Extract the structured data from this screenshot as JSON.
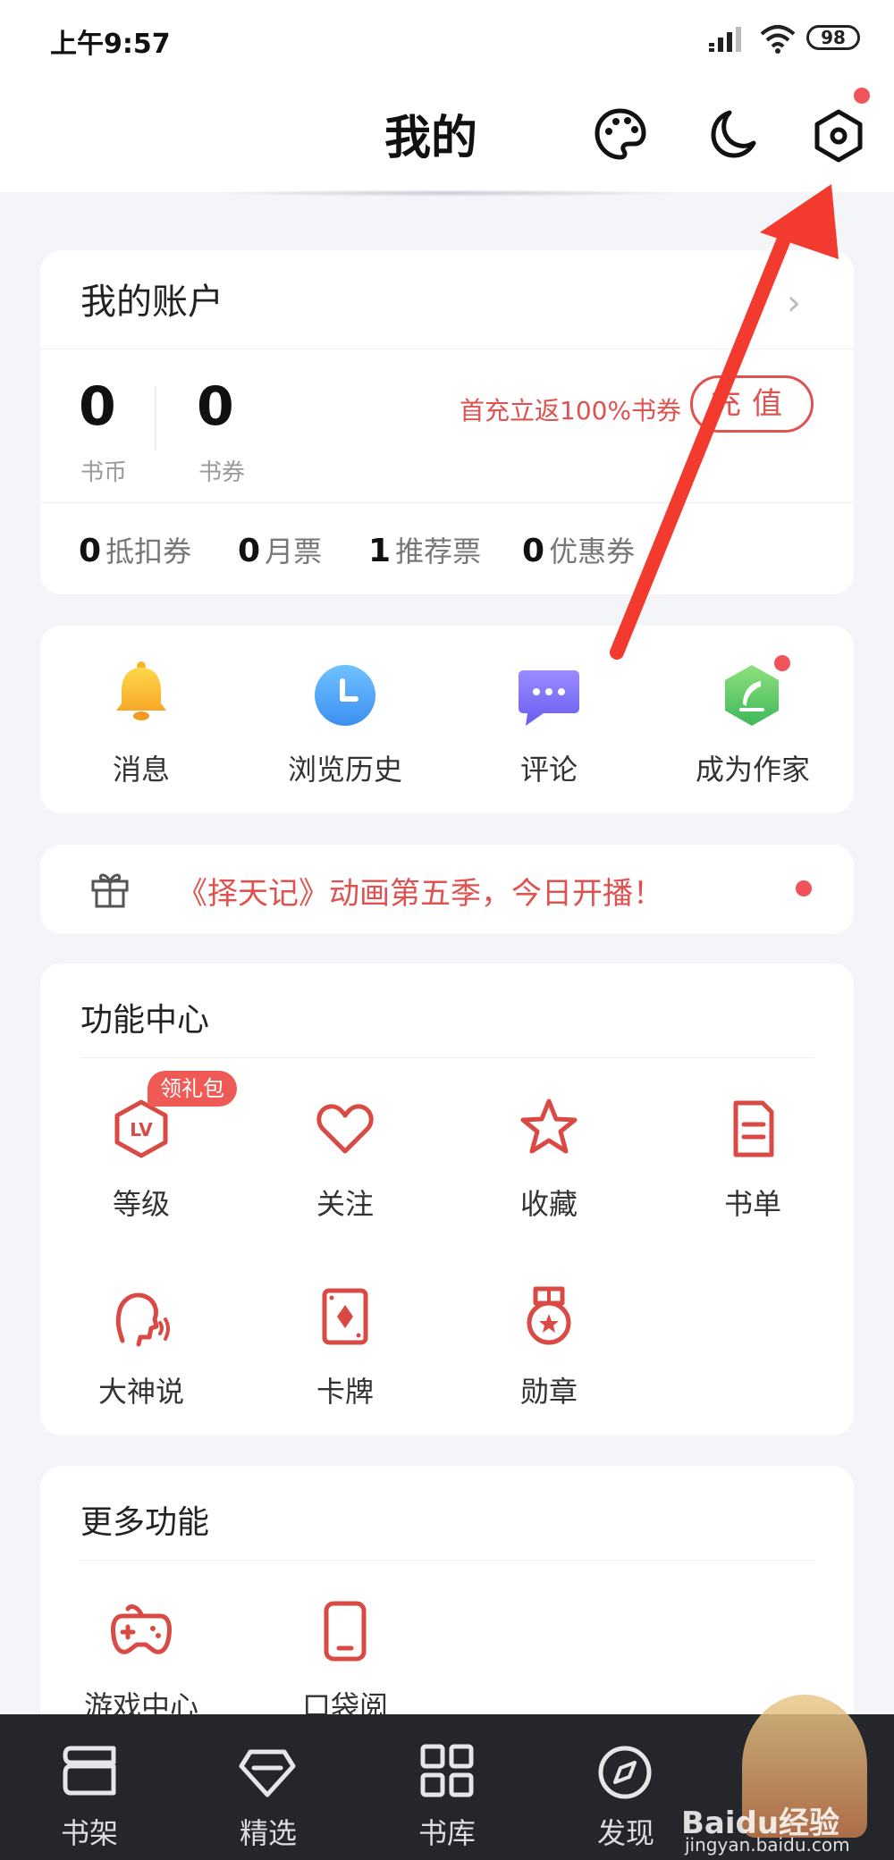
{
  "status_bar": {
    "time": "上午9:57",
    "battery": "98"
  },
  "header": {
    "title": "我的"
  },
  "account": {
    "title": "我的账户",
    "coins": {
      "value": "0",
      "label": "书币"
    },
    "coupons": {
      "value": "0",
      "label": "书券"
    },
    "promo": "首充立返100%书券",
    "recharge_label": "充值",
    "tickets": [
      {
        "value": "0",
        "label": "抵扣券"
      },
      {
        "value": "0",
        "label": "月票"
      },
      {
        "value": "1",
        "label": "推荐票"
      },
      {
        "value": "0",
        "label": "优惠券"
      }
    ]
  },
  "quick": [
    {
      "label": "消息",
      "icon": "bell-icon"
    },
    {
      "label": "浏览历史",
      "icon": "clock-icon"
    },
    {
      "label": "评论",
      "icon": "chat-bubble-icon"
    },
    {
      "label": "成为作家",
      "icon": "feather-icon"
    }
  ],
  "banner": {
    "text": "《择天记》动画第五季，今日开播！",
    "icon": "gift-icon"
  },
  "features": {
    "title": "功能中心",
    "badge": "领礼包",
    "items": [
      {
        "label": "等级",
        "icon": "level-icon"
      },
      {
        "label": "关注",
        "icon": "heart-icon"
      },
      {
        "label": "收藏",
        "icon": "star-icon"
      },
      {
        "label": "书单",
        "icon": "book-list-icon"
      },
      {
        "label": "大神说",
        "icon": "talking-head-icon"
      },
      {
        "label": "卡牌",
        "icon": "card-icon"
      },
      {
        "label": "勋章",
        "icon": "medal-icon"
      }
    ]
  },
  "more": {
    "title": "更多功能",
    "items": [
      {
        "label": "游戏中心",
        "icon": "gamepad-icon"
      },
      {
        "label": "口袋阅",
        "icon": "phone-icon"
      }
    ]
  },
  "nav": [
    {
      "label": "书架",
      "icon": "bookshelf-icon"
    },
    {
      "label": "精选",
      "icon": "diamond-icon"
    },
    {
      "label": "书库",
      "icon": "grid-icon"
    },
    {
      "label": "发现",
      "icon": "compass-icon"
    }
  ],
  "watermark": {
    "brand": "Baidu经验",
    "url": "jingyan.baidu.com"
  },
  "colors": {
    "accent": "#e0524f",
    "nav_bg": "#24262b",
    "page_bg": "#f4f5f9"
  }
}
